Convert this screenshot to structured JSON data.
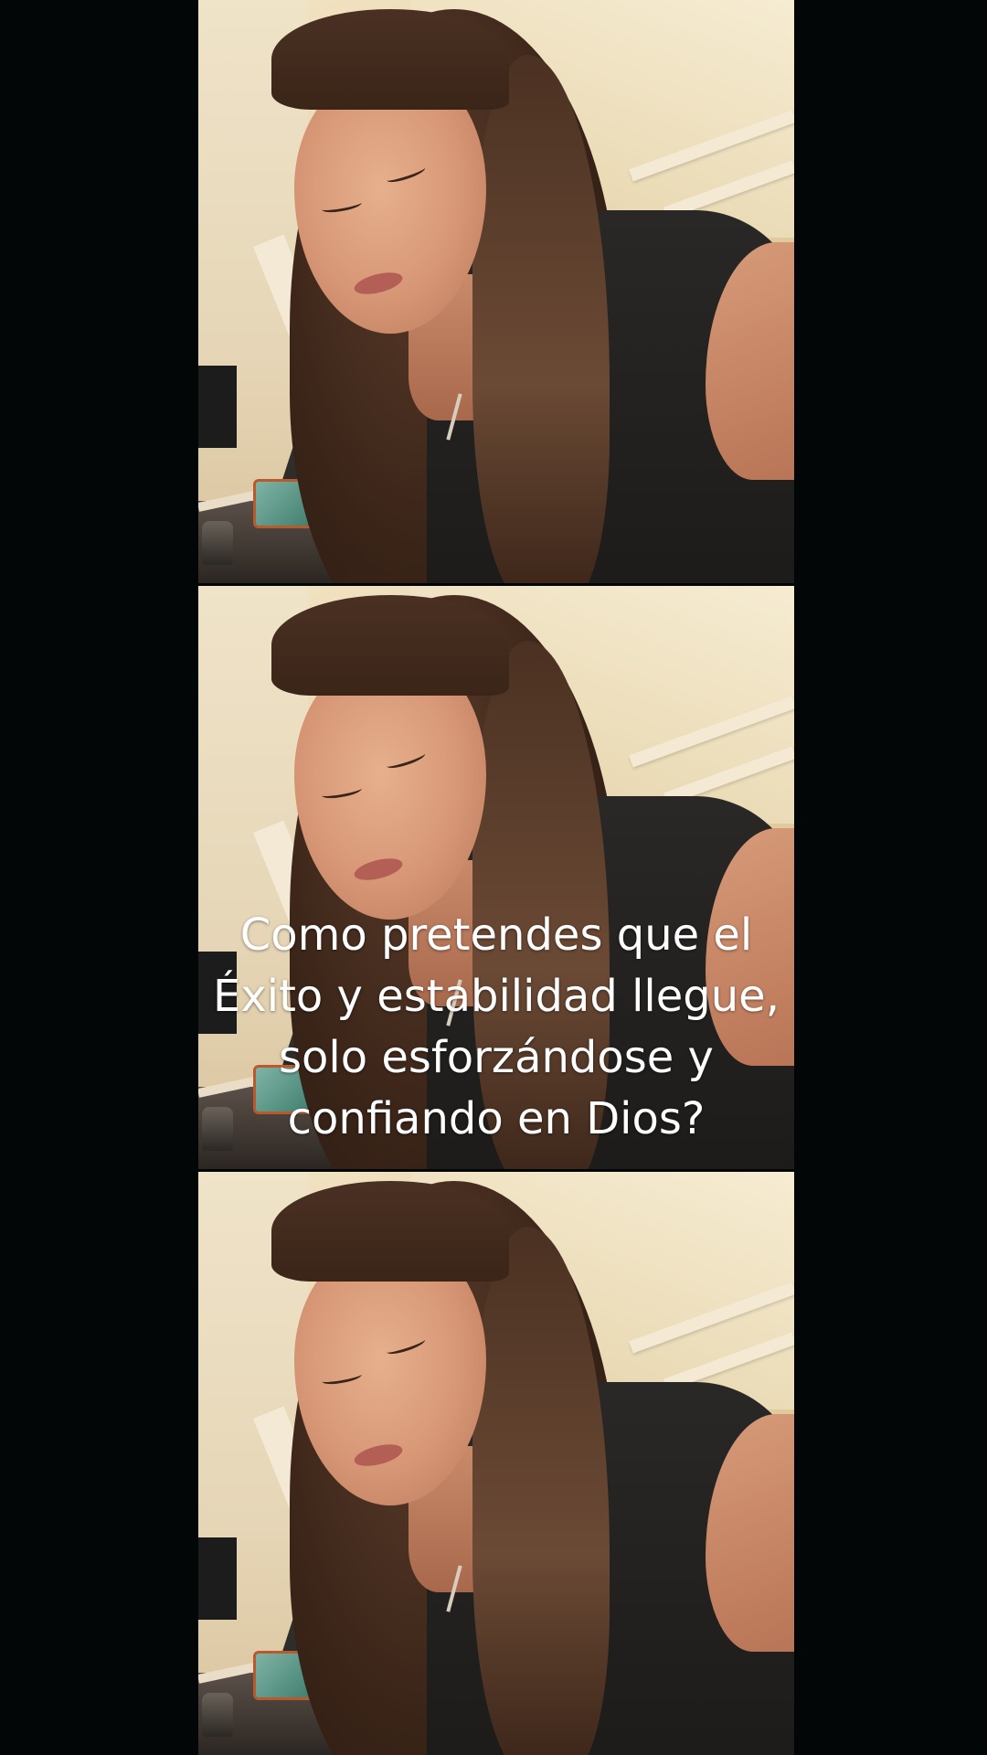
{
  "video": {
    "caption_lines": [
      "Como pretendes que el",
      "Éxito y estabilidad llegue,",
      "solo esforzándose y",
      "confiando en Dios?"
    ]
  },
  "colors": {
    "background": "#030606",
    "caption_text": "#ffffff"
  }
}
